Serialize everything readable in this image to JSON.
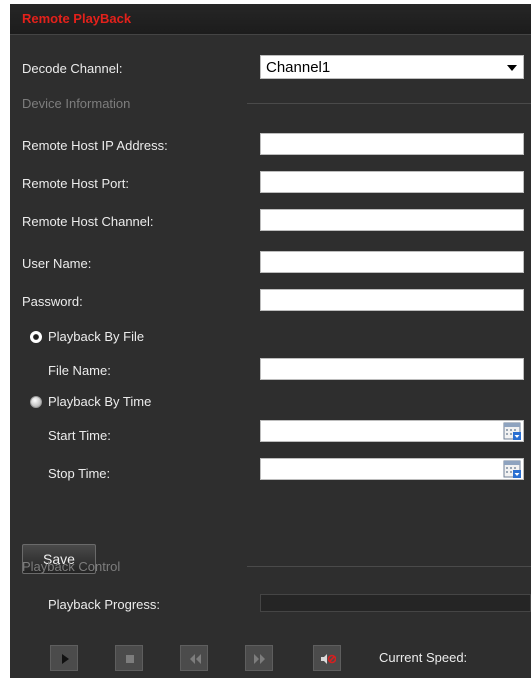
{
  "panel": {
    "title": "Remote PlayBack"
  },
  "decode": {
    "label": "Decode Channel:",
    "selected": "Channel1"
  },
  "device_info": {
    "heading": "Device Information",
    "fields": [
      {
        "label": "Remote Host IP Address:",
        "value": ""
      },
      {
        "label": "Remote Host Port:",
        "value": ""
      },
      {
        "label": "Remote Host Channel:",
        "value": ""
      },
      {
        "label": "User Name:",
        "value": ""
      },
      {
        "label": "Password:",
        "value": ""
      }
    ]
  },
  "mode": {
    "by_file": {
      "label": "Playback By File",
      "checked": true,
      "file_name_label": "File Name:",
      "file_name": ""
    },
    "by_time": {
      "label": "Playback By Time",
      "checked": false,
      "start_label": "Start Time:",
      "start_value": "",
      "stop_label": "Stop Time:",
      "stop_value": ""
    }
  },
  "save_label": "Save",
  "control": {
    "heading": "Playback Control",
    "progress_label": "Playback Progress:",
    "progress": 0,
    "speed_label": "Current Speed:",
    "speed_value": "",
    "buttons": [
      "play-icon",
      "stop-icon",
      "rewind-icon",
      "fast-forward-icon",
      "mute-icon"
    ]
  },
  "colors": {
    "title": "#e3211b",
    "panel_bg": "#2e2e2e",
    "section_text": "#7d7d7d"
  }
}
